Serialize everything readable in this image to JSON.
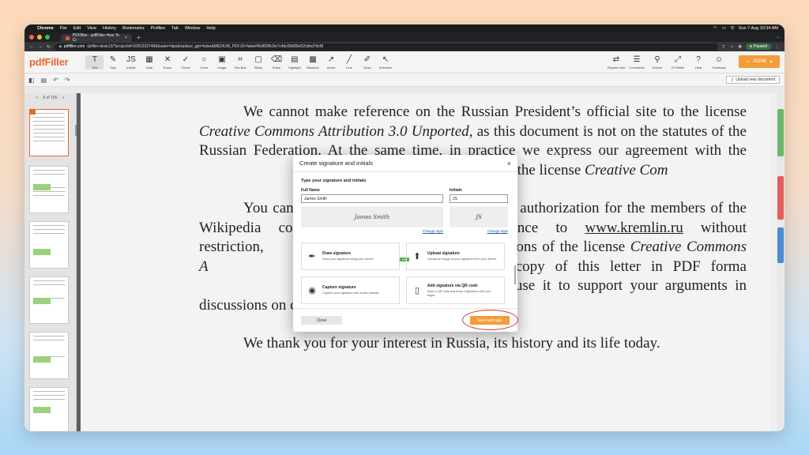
{
  "menubar": {
    "app": "Chrome",
    "items": [
      "File",
      "Edit",
      "View",
      "History",
      "Bookmarks",
      "Profiles",
      "Tab",
      "Window",
      "Help"
    ],
    "clock": "Sun 7 Aug  10:34 AM"
  },
  "browser": {
    "tab_title": "PDFfiller - pdfFiller How To Cr",
    "url_host": "pdffiller.com",
    "url_path": "/jsfiller-desk13/?projectId=1081232748&loader=tips&replace_gpt=false&MEDIUM_PDFJS=false#f6d658fc9e7c4dc0b689e52cbbd7dcf8",
    "profile": "Paused"
  },
  "app": {
    "logo": "pdfFiller",
    "tools": [
      {
        "name": "text",
        "label": "Text",
        "glyph": "T"
      },
      {
        "name": "sign",
        "label": "Sign",
        "glyph": "✎"
      },
      {
        "name": "initials",
        "label": "Initials",
        "glyph": "JS"
      },
      {
        "name": "date",
        "label": "Date",
        "glyph": "▦"
      },
      {
        "name": "erase",
        "label": "Erase",
        "glyph": "✕"
      },
      {
        "name": "check",
        "label": "Check",
        "glyph": "✓"
      },
      {
        "name": "circle",
        "label": "Circle",
        "glyph": "○"
      },
      {
        "name": "image",
        "label": "Image",
        "glyph": "▣"
      },
      {
        "name": "textbox",
        "label": "Text Box",
        "glyph": "⌗"
      },
      {
        "name": "sticky",
        "label": "Sticky",
        "glyph": "▢"
      },
      {
        "name": "erase2",
        "label": "Erase",
        "glyph": "⌫"
      },
      {
        "name": "highlight",
        "label": "Highlight",
        "glyph": "▤"
      },
      {
        "name": "blackout",
        "label": "Blackout",
        "glyph": "▩"
      },
      {
        "name": "arrow",
        "label": "Arrow",
        "glyph": "↗"
      },
      {
        "name": "line",
        "label": "Line",
        "glyph": "╱"
      },
      {
        "name": "draw",
        "label": "Draw",
        "glyph": "✐"
      },
      {
        "name": "selection",
        "label": "Selection",
        "glyph": "↖"
      }
    ],
    "right_tools": [
      {
        "name": "replace-text",
        "label": "Replace text",
        "glyph": "⇄"
      },
      {
        "name": "comments",
        "label": "Comments",
        "glyph": "☰"
      },
      {
        "name": "search",
        "label": "Search",
        "glyph": "⚲"
      },
      {
        "name": "fit-width",
        "label": "Fit Width",
        "glyph": "⤢"
      },
      {
        "name": "help",
        "label": "Help",
        "glyph": "?"
      },
      {
        "name": "feedback",
        "label": "Feedback",
        "glyph": "☺"
      }
    ],
    "done_label": "DONE",
    "upload_label": "Upload new document",
    "page_nav": "6 of 156"
  },
  "document": {
    "p1_a": "We cannot make reference on the Russian President’s official site to the license ",
    "p1_em": "Creative Commons Attribution 3.0 Unported",
    "p1_b": ", as this document is not on the statutes of the Russian Federation. At the same time, in practice we express our agreement with the ",
    "p1_c": "ght policy as reflected in the license ",
    "p1_em2": "Creative Com",
    "p2_a": "You can consi",
    "p2_b": "authorization for the members of the Wikipedia co",
    "p2_c": "reference to ",
    "p2_link": "www.kremlin.ru",
    "p2_d": " without restriction, ",
    "p2_e": "le conditions of the license ",
    "p2_em": "Creative Commons A",
    "p2_f": "can also post a copy of this letter in PDF forma",
    "p2_g": "e, enabling you to use it to support your argume",
    "p2_h": "nts in discussions on copyright issues.",
    "p3": "We thank you for your interest in Russia, its history and its life today."
  },
  "modal": {
    "title": "Create signature and initials",
    "section": "Type your signature and initials",
    "full_name_label": "Full Name",
    "full_name_value": "James Smith",
    "initials_label": "Initials",
    "initials_value": "JS",
    "sig_preview": "James Smith",
    "init_preview": "JS",
    "change_style": "Change style",
    "or": "OR",
    "options": [
      {
        "title": "Draw signature",
        "desc": "Draw your signature using your device."
      },
      {
        "title": "Upload signature",
        "desc": "Upload an image of your signature from your device."
      },
      {
        "title": "Capture signature",
        "desc": "Capture your signature with a web camera."
      },
      {
        "title": "Add signature via QR code",
        "desc": "Scan a QR code and draw a signature with your finger."
      }
    ],
    "close_label": "Close",
    "save_label": "Save and sign"
  },
  "colors": {
    "accent": "#f29d38",
    "logo": "#e8692c",
    "highlight_ring": "#d3342c"
  }
}
